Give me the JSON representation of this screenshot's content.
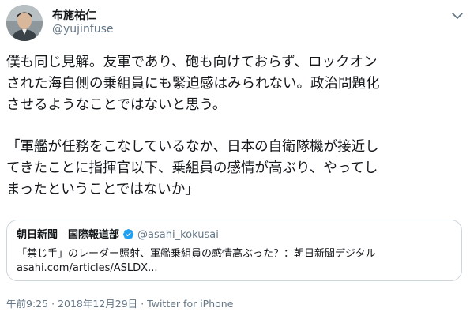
{
  "author": {
    "display_name": "布施祐仁",
    "handle": "@yujinfuse"
  },
  "tweet": {
    "lines": [
      "僕も同じ見解。友軍であり、砲も向けておらず、ロックオン",
      "された海自側の乗組員にも緊迫感はみられない。政治問題化",
      "させるようなことではないと思う。",
      "「軍艦が任務をこなしているなか、日本の自衛隊機が接近し",
      "てきたことに指揮官以下、乗組員の感情が高ぶり、やってし",
      "まったということではないか」"
    ]
  },
  "quote": {
    "name": "朝日新聞　国際報道部",
    "handle": "@asahi_kokusai",
    "text_line1": "「禁じ手」のレーダー照射、軍艦乗組員の感情高ぶった？：朝日新聞デジタル",
    "text_line2": "asahi.com/articles/ASLDX..."
  },
  "meta": {
    "time": "午前9:25",
    "separator1": "·",
    "date": "2018年12月29日",
    "separator2": "·",
    "client": "Twitter for iPhone"
  },
  "colors": {
    "text": "#14171a",
    "secondary": "#657786",
    "border": "#ccd6dd",
    "verified": "#1da1f2"
  },
  "icons": {
    "caret": "chevron-down-icon",
    "verified": "verified-badge-icon",
    "avatar": "avatar"
  }
}
